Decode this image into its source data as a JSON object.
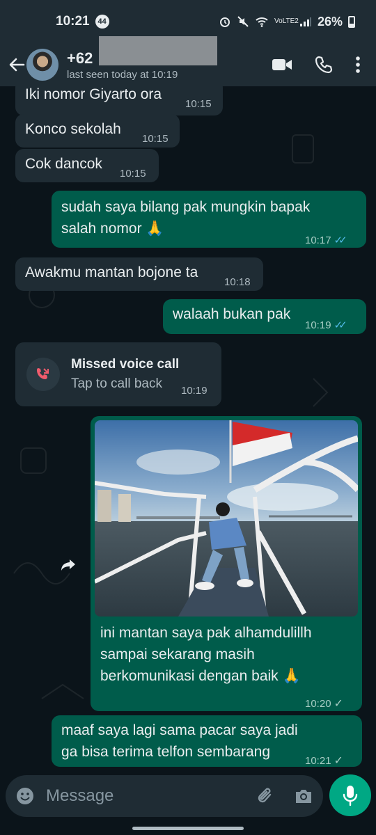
{
  "status_bar": {
    "time": "10:21",
    "badge": "44",
    "battery": "26%",
    "network": "VoLTE2"
  },
  "header": {
    "contact_prefix": "+62",
    "last_seen": "last seen today at 10:19",
    "icons": [
      "back-arrow-icon",
      "video-call-icon",
      "phone-icon",
      "more-vert-icon"
    ]
  },
  "messages": [
    {
      "dir": "in",
      "text": "Iki nomor Giyarto ora",
      "time": "10:15"
    },
    {
      "dir": "in",
      "text": "Konco sekolah",
      "time": "10:15"
    },
    {
      "dir": "in",
      "text": "Cok dancok",
      "time": "10:15"
    },
    {
      "dir": "out",
      "text": "sudah saya bilang pak mungkin bapak salah nomor 🙏",
      "time": "10:17",
      "status": "read"
    },
    {
      "dir": "in",
      "text": "Awakmu mantan bojone ta",
      "time": "10:18"
    },
    {
      "dir": "out",
      "text": "walaah bukan pak",
      "time": "10:19",
      "status": "read"
    },
    {
      "dir": "in",
      "type": "call",
      "title": "Missed voice call",
      "subtitle": "Tap to call back",
      "time": "10:19"
    },
    {
      "dir": "out",
      "type": "image",
      "text": "ini mantan saya pak alhamdulillh sampai sekarang masih berkomunikasi dengan baik 🙏",
      "time": "10:20",
      "status": "sent"
    },
    {
      "dir": "out",
      "text": "maaf saya lagi sama pacar saya jadi ga bisa terima telfon sembarang",
      "time": "10:21",
      "status": "sent"
    }
  ],
  "input": {
    "placeholder": "Message"
  },
  "colors": {
    "incoming_bubble": "#1f2c34",
    "outgoing_bubble": "#005c4b",
    "accent": "#00a884",
    "read_tick": "#53bdeb",
    "background": "#0b141a"
  }
}
